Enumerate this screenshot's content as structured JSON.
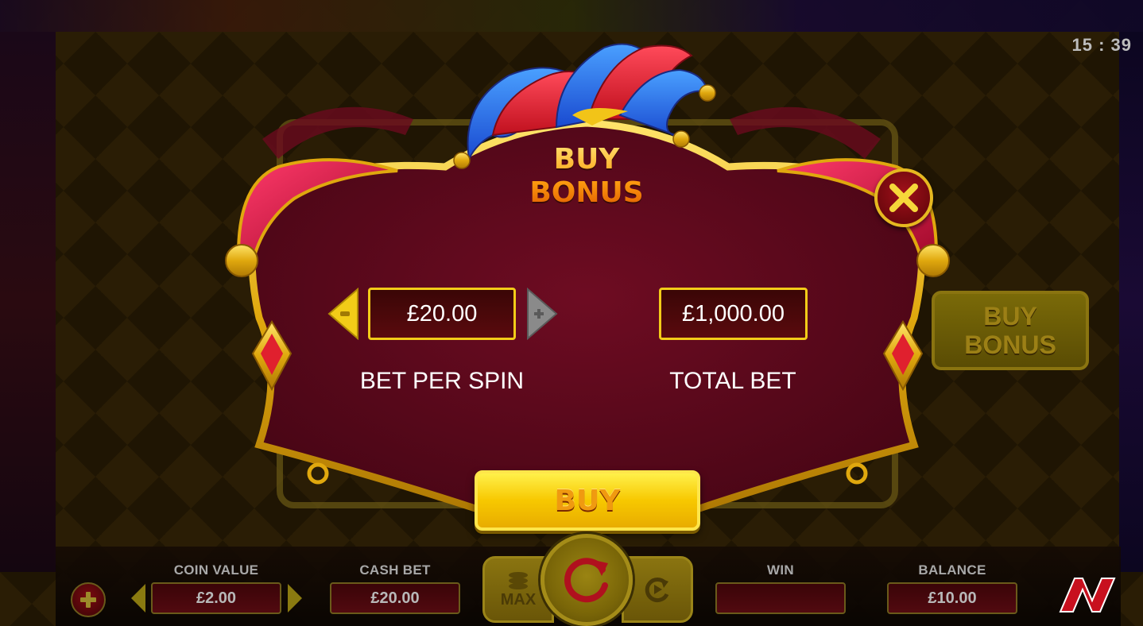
{
  "clock": "15 : 39",
  "side_buy_bonus": {
    "line1": "BUY",
    "line2": "BONUS"
  },
  "modal": {
    "title_line1": "BUY",
    "title_line2": "BONUS",
    "bet_per_spin": {
      "value": "£20.00",
      "label": "BET PER SPIN"
    },
    "total_bet": {
      "value": "£1,000.00",
      "label": "TOTAL BET"
    },
    "buy_label": "BUY",
    "minus_icon": "minus-icon",
    "plus_icon": "plus-icon",
    "close_icon": "close-icon"
  },
  "hud": {
    "coin_value": {
      "title": "COIN VALUE",
      "value": "£2.00"
    },
    "cash_bet": {
      "title": "CASH BET",
      "value": "£20.00"
    },
    "max_label": "MAX",
    "win": {
      "title": "WIN",
      "value": ""
    },
    "balance": {
      "title": "BALANCE",
      "value": "£10.00"
    }
  },
  "colors": {
    "panel": "#5a0a1e",
    "gold": "#f2cc18",
    "buy_button": "#f7c800",
    "title_orange": "#ffa010"
  }
}
